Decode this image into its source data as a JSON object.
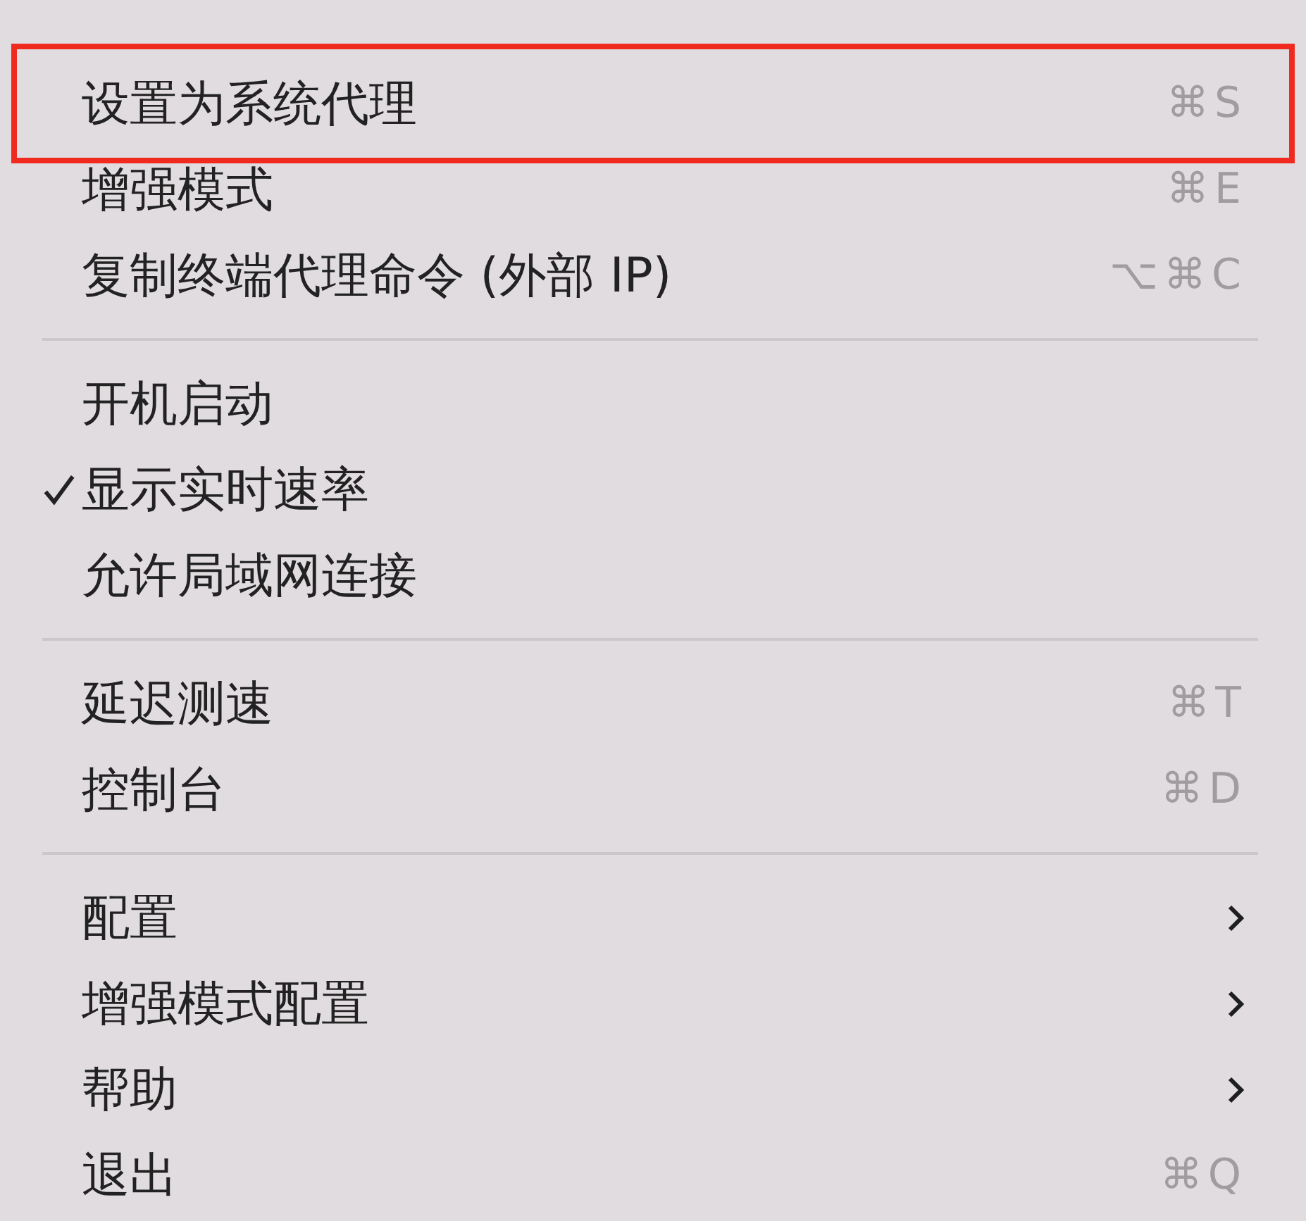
{
  "menu": {
    "groups": [
      {
        "items": [
          {
            "kind": "shortcut",
            "label": "设置为系统代理",
            "shortcut": "⌘S",
            "checked": false,
            "highlighted": true
          },
          {
            "kind": "shortcut",
            "label": "增强模式",
            "shortcut": "⌘E",
            "checked": false,
            "highlighted": false
          },
          {
            "kind": "shortcut",
            "label": "复制终端代理命令 (外部 IP)",
            "shortcut": "⌥⌘C",
            "checked": false,
            "highlighted": false
          }
        ]
      },
      {
        "items": [
          {
            "kind": "plain",
            "label": "开机启动",
            "checked": false,
            "highlighted": false
          },
          {
            "kind": "plain",
            "label": "显示实时速率",
            "checked": true,
            "highlighted": false
          },
          {
            "kind": "plain",
            "label": "允许局域网连接",
            "checked": false,
            "highlighted": false
          }
        ]
      },
      {
        "items": [
          {
            "kind": "shortcut",
            "label": "延迟测速",
            "shortcut": "⌘T",
            "checked": false,
            "highlighted": false
          },
          {
            "kind": "shortcut",
            "label": "控制台",
            "shortcut": "⌘D",
            "checked": false,
            "highlighted": false
          }
        ]
      },
      {
        "items": [
          {
            "kind": "submenu",
            "label": "配置",
            "checked": false,
            "highlighted": false
          },
          {
            "kind": "submenu",
            "label": "增强模式配置",
            "checked": false,
            "highlighted": false
          },
          {
            "kind": "submenu",
            "label": "帮助",
            "checked": false,
            "highlighted": false
          },
          {
            "kind": "shortcut",
            "label": "退出",
            "shortcut": "⌘Q",
            "checked": false,
            "highlighted": false
          }
        ]
      }
    ]
  }
}
